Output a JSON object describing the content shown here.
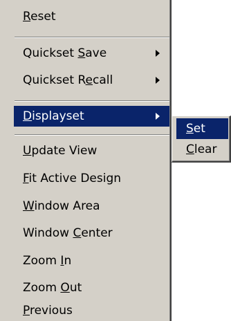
{
  "menu": {
    "items": [
      {
        "pre": "",
        "acc": "R",
        "post": "eset",
        "submenu": false
      },
      {
        "pre": "Quickset ",
        "acc": "S",
        "post": "ave",
        "submenu": true
      },
      {
        "pre": "Quickset R",
        "acc": "e",
        "post": "call",
        "submenu": true
      },
      {
        "pre": "",
        "acc": "D",
        "post": "isplayset",
        "submenu": true,
        "highlighted": true
      },
      {
        "pre": "",
        "acc": "U",
        "post": "pdate View",
        "submenu": false
      },
      {
        "pre": "",
        "acc": "F",
        "post": "it Active Design",
        "submenu": false
      },
      {
        "pre": "",
        "acc": "W",
        "post": "indow Area",
        "submenu": false
      },
      {
        "pre": "Window ",
        "acc": "C",
        "post": "enter",
        "submenu": false
      },
      {
        "pre": "Zoom ",
        "acc": "I",
        "post": "n",
        "submenu": false
      },
      {
        "pre": "Zoom ",
        "acc": "O",
        "post": "ut",
        "submenu": false
      },
      {
        "pre": "",
        "acc": "P",
        "post": "revious",
        "submenu": false
      }
    ]
  },
  "submenu": {
    "items": [
      {
        "pre": "",
        "acc": "S",
        "post": "et",
        "highlighted": true
      },
      {
        "pre": "",
        "acc": "C",
        "post": "lear"
      }
    ]
  },
  "colors": {
    "menu_background": "#d4d0c8",
    "highlight_background": "#0a246a",
    "highlight_text": "#ffffff",
    "text": "#000000"
  }
}
